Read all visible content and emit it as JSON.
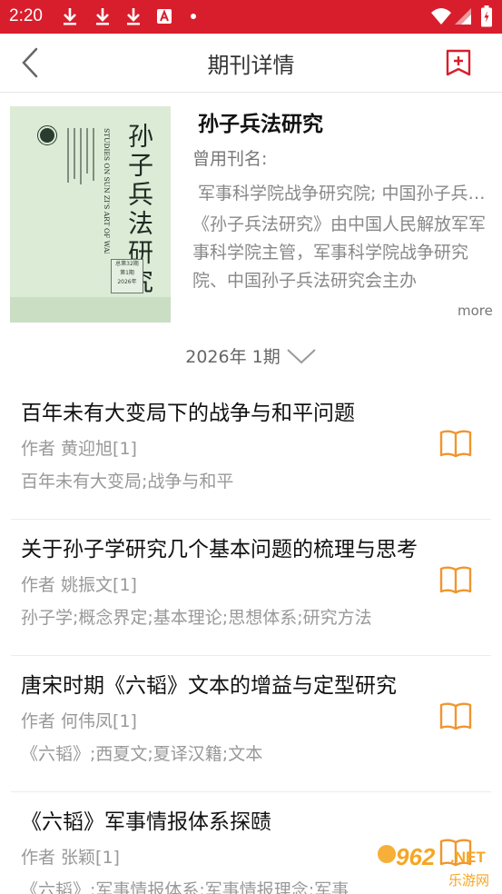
{
  "status_bar": {
    "time": "2:20",
    "icons": [
      "download-icon",
      "download-icon",
      "download-icon",
      "font-icon",
      "dot",
      "wifi-icon",
      "signal-icon",
      "battery-icon"
    ]
  },
  "nav": {
    "title": "期刊详情",
    "back_icon": "chevron-left-icon",
    "bookmark_icon": "bookmark-add-icon",
    "accent_color": "#d81e2c"
  },
  "journal": {
    "name": "孙子兵法研究",
    "former_name_label": "曾用刊名:",
    "former_name_value": "军事科学院战争研究院;  中国孙子兵法研究会",
    "description": "《孙子兵法研究》由中国人民解放军军事科学院主管，军事科学院战争研究院、中国孙子兵法研究会主办",
    "more_label": "more",
    "cover": {
      "cn_title": "孙子兵法研究",
      "en_title": "STUDIES ON SUN ZI'S ART OF WAR",
      "issue_line1": "总第32期",
      "issue_line2": "第1期",
      "issue_line3": "2026年"
    }
  },
  "issue_selector": {
    "label": "2026年 1期",
    "icon": "chevron-down-icon"
  },
  "articles": [
    {
      "title": "百年未有大变局下的战争与和平问题",
      "author": "作者 黄迎旭[1]",
      "keywords": "百年未有大变局;战争与和平",
      "icon": "book-open-icon"
    },
    {
      "title": "关于孙子学研究几个基本问题的梳理与思考",
      "author": "作者 姚振文[1]",
      "keywords": "孙子学;概念界定;基本理论;思想体系;研究方法",
      "icon": "book-open-icon"
    },
    {
      "title": "唐宋时期《六韬》文本的增益与定型研究",
      "author": "作者 何伟凤[1]",
      "keywords": "《六韬》;西夏文;夏译汉籍;文本",
      "icon": "book-open-icon"
    },
    {
      "title": "《六韬》军事情报体系探赜",
      "author": "作者 张颖[1]",
      "keywords": "《六韬》;军事情报体系;军事情报理念;军事",
      "icon": "book-open-icon"
    }
  ],
  "watermark": {
    "number": "962",
    "suffix": ".NET",
    "caption": "乐游网"
  }
}
